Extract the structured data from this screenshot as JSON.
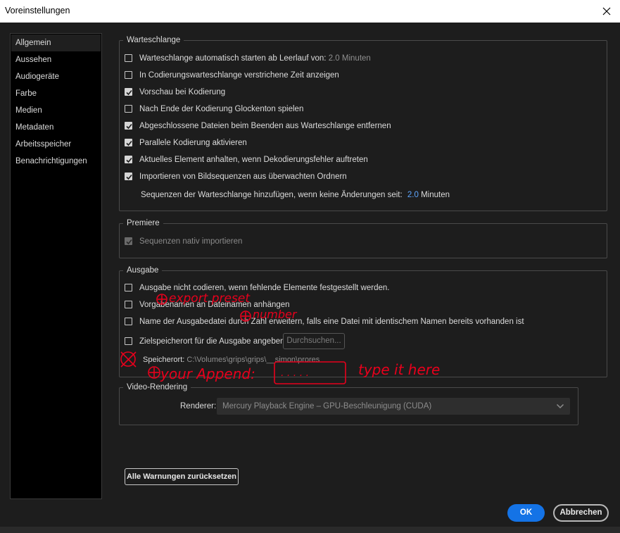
{
  "window": {
    "title": "Voreinstellungen"
  },
  "sidebar": {
    "items": [
      {
        "label": "Allgemein"
      },
      {
        "label": "Aussehen"
      },
      {
        "label": "Audiogeräte"
      },
      {
        "label": "Farbe"
      },
      {
        "label": "Medien"
      },
      {
        "label": "Metadaten"
      },
      {
        "label": "Arbeitsspeicher"
      },
      {
        "label": "Benachrichtigungen"
      }
    ],
    "selected": "Allgemein"
  },
  "queue": {
    "legend": "Warteschlange",
    "auto_start": {
      "label": "Warteschlange automatisch starten ab Leerlauf von:",
      "value": "2.0",
      "unit": "Minuten",
      "checked": false
    },
    "elapsed": {
      "label": "In Codierungswarteschlange verstrichene Zeit anzeigen",
      "checked": false
    },
    "preview": {
      "label": "Vorschau bei Kodierung",
      "checked": true
    },
    "chime": {
      "label": "Nach Ende der Kodierung Glockenton spielen",
      "checked": false
    },
    "remove": {
      "label": "Abgeschlossene Dateien beim Beenden aus Warteschlange entfernen",
      "checked": true
    },
    "parallel": {
      "label": "Parallele Kodierung aktivieren",
      "checked": true
    },
    "pause": {
      "label": "Aktuelles Element anhalten, wenn Dekodierungsfehler auftreten",
      "checked": true
    },
    "import": {
      "label": "Importieren von Bildsequenzen aus überwachten Ordnern",
      "checked": true
    },
    "seq_label": "Sequenzen der Warteschlange hinzufügen, wenn keine Änderungen seit:",
    "seq_value": "2.0",
    "seq_unit": "Minuten"
  },
  "premiere": {
    "legend": "Premiere",
    "native": {
      "label": "Sequenzen nativ importieren",
      "checked": true,
      "disabled": true
    }
  },
  "output": {
    "legend": "Ausgabe",
    "no_encode": {
      "label": "Ausgabe nicht codieren, wenn fehlende Elemente festgestellt werden.",
      "checked": false
    },
    "preset_names": {
      "label": "Vorgabenamen an Dateinamen anhängen",
      "checked": false
    },
    "increment": {
      "label": "Name der Ausgabedatei durch Zahl erweitern, falls eine Datei mit identischem Namen bereits vorhanden ist",
      "checked": false
    },
    "destination": {
      "label": "Zielspeicherort für die Ausgabe angeben:",
      "checked": false
    },
    "browse_label": "Durchsuchen...",
    "location_label": "Speicherort:",
    "location_value": "C:\\Volumes\\grips\\grips\\__simon\\prores"
  },
  "rendering": {
    "legend": "Video-Rendering",
    "renderer_label": "Renderer:",
    "renderer_value": "Mercury Playback Engine – GPU-Beschleunigung (CUDA)"
  },
  "buttons": {
    "reset_warnings": "Alle Warnungen zurücksetzen",
    "ok": "OK",
    "cancel": "Abbrechen"
  },
  "annotations": {
    "preset_note": "export preset",
    "number_note": "number",
    "append_note": "your Append:",
    "append_box": ". . . . .",
    "type_note": "type it here"
  },
  "colors": {
    "background": "#1d1d1d",
    "accent": "#1473e6",
    "value_blue": "#5ea6ff",
    "annotation_red": "#e8001c"
  },
  "icons": {
    "close": "close-icon",
    "checkmark": "check-icon",
    "dropdown": "chevron-down-icon"
  }
}
